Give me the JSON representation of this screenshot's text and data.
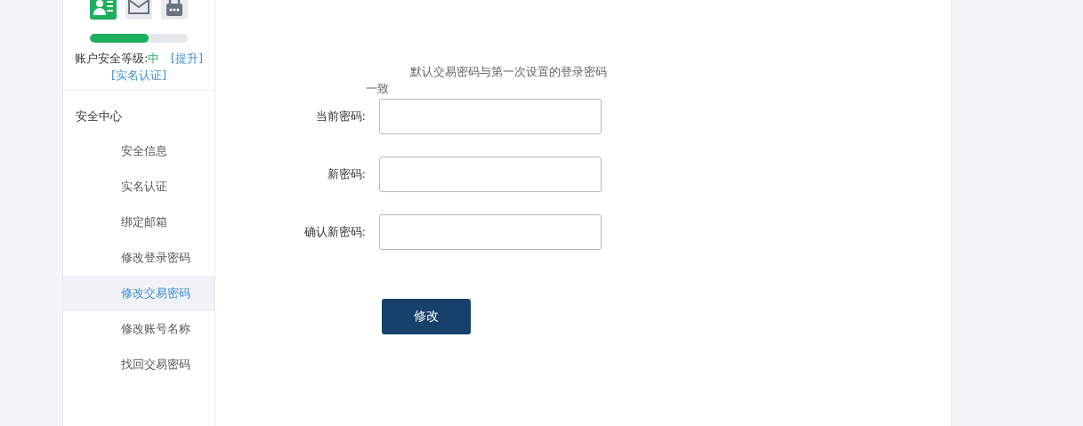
{
  "sidebar": {
    "security": {
      "level": 0.6,
      "label": "账户安全等级:",
      "value": "中",
      "upgrade_link": "[提升]",
      "verify_link": "[实名认证]"
    },
    "menu": {
      "title": "安全中心",
      "items": [
        {
          "label": "安全信息",
          "selected": false
        },
        {
          "label": "实名认证",
          "selected": false
        },
        {
          "label": "绑定邮箱",
          "selected": false
        },
        {
          "label": "修改登录密码",
          "selected": false
        },
        {
          "label": "修改交易密码",
          "selected": true
        },
        {
          "label": "修改账号名称",
          "selected": false
        },
        {
          "label": "找回交易密码",
          "selected": false
        }
      ]
    }
  },
  "form": {
    "hint": "默认交易密码与第一次设置的登录密码一致",
    "fields": [
      {
        "label": "当前密码:"
      },
      {
        "label": "新密码:"
      },
      {
        "label": "确认新密码:"
      }
    ],
    "submit": "修改"
  }
}
